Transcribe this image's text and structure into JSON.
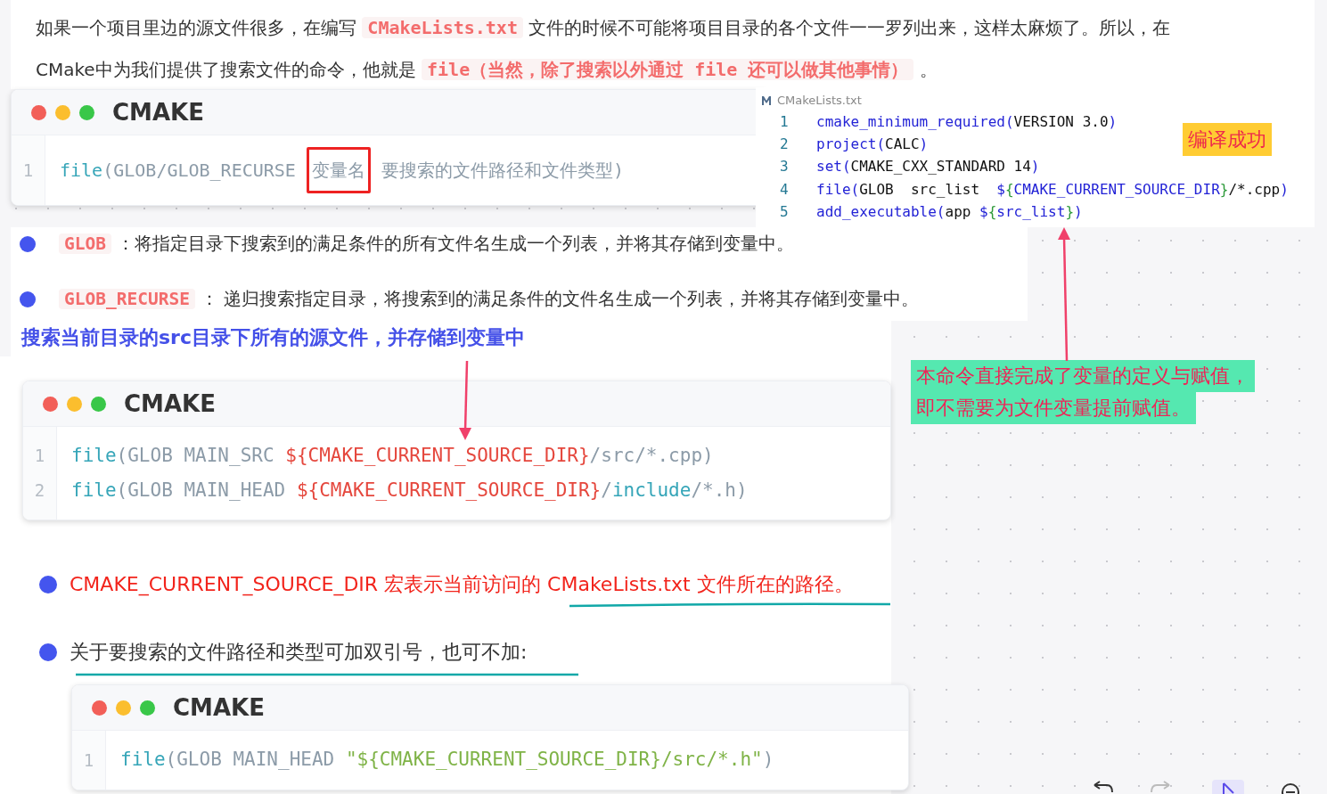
{
  "intro": {
    "lines": [
      [
        {
          "kind": "text",
          "text": "如果一个项目里边的源文件很多，在编写 "
        },
        {
          "kind": "code",
          "text": "CMakeLists.txt"
        },
        {
          "kind": "text",
          "text": " 文件的时候不可能将项目目录的各个文件一一罗列出来，这样太麻烦了。所以，在"
        }
      ],
      [
        {
          "kind": "text",
          "text": "CMake中为我们提供了搜索文件的命令，他就是 "
        },
        {
          "kind": "code",
          "text": "file（当然，除了搜索以外通过 file 还可以做其他事情）"
        },
        {
          "kind": "text",
          "text": " 。"
        }
      ]
    ]
  },
  "syntax_block": {
    "title": "CMAKE",
    "lines": [
      {
        "number": "1",
        "tokens": [
          {
            "kind": "keyword",
            "text": "file"
          },
          {
            "kind": "plain",
            "text": "(GLOB/GLOB_RECURSE "
          },
          {
            "kind": "boxed",
            "text": "变量名"
          },
          {
            "kind": "plain",
            "text": " 要搜索的文件路径和文件类型)"
          }
        ]
      }
    ]
  },
  "file_clip": {
    "filename": "CMakeLists.txt",
    "badge": "编译成功",
    "lines": [
      {
        "number": "1",
        "tokens": [
          {
            "kind": "func",
            "text": "cmake_minimum_required("
          },
          {
            "kind": "text",
            "text": "VERSION 3.0"
          },
          {
            "kind": "func",
            "text": ")"
          }
        ]
      },
      {
        "number": "2",
        "tokens": [
          {
            "kind": "func",
            "text": "project("
          },
          {
            "kind": "text",
            "text": "CALC"
          },
          {
            "kind": "func",
            "text": ")"
          }
        ]
      },
      {
        "number": "3",
        "tokens": [
          {
            "kind": "func",
            "text": "set("
          },
          {
            "kind": "text",
            "text": "CMAKE_CXX_STANDARD 14"
          },
          {
            "kind": "func",
            "text": ")"
          }
        ]
      },
      {
        "number": "4",
        "tokens": [
          {
            "kind": "func",
            "text": "file("
          },
          {
            "kind": "text",
            "text": "GLOB  src_list  "
          },
          {
            "kind": "func",
            "text": "$"
          },
          {
            "kind": "brace",
            "text": "{"
          },
          {
            "kind": "func",
            "text": "CMAKE_CURRENT_SOURCE_DIR"
          },
          {
            "kind": "brace",
            "text": "}"
          },
          {
            "kind": "text",
            "text": "/*.cpp"
          },
          {
            "kind": "func",
            "text": ")"
          }
        ]
      },
      {
        "number": "5",
        "tokens": [
          {
            "kind": "func",
            "text": "add_executable("
          },
          {
            "kind": "text",
            "text": "app "
          },
          {
            "kind": "func",
            "text": "$"
          },
          {
            "kind": "brace",
            "text": "{"
          },
          {
            "kind": "func",
            "text": "src_list"
          },
          {
            "kind": "brace",
            "text": "}"
          },
          {
            "kind": "func",
            "text": ")"
          }
        ]
      }
    ]
  },
  "bullets_top": [
    [
      {
        "kind": "code",
        "text": "GLOB"
      },
      {
        "kind": "text",
        "text": " ：将指定目录下搜索到的满足条件的所有文件名生成一个列表，并将其存储到变量中。"
      }
    ],
    [
      {
        "kind": "code",
        "text": "GLOB_RECURSE"
      },
      {
        "kind": "text",
        "text": " ： 递归搜索指定目录，将搜索到的满足条件的文件名生成一个列表，并将其存储到变量中。"
      }
    ]
  ],
  "heading": "搜索当前目录的src目录下所有的源文件，并存储到变量中",
  "note": {
    "lines": [
      "本命令直接完成了变量的定义与赋值，",
      "即不需要为文件变量提前赋值。"
    ]
  },
  "example_block": {
    "title": "CMAKE",
    "lines": [
      {
        "number": "1",
        "tokens": [
          {
            "kind": "keyword",
            "text": "file"
          },
          {
            "kind": "plain",
            "text": "(GLOB MAIN_SRC "
          },
          {
            "kind": "var",
            "text": "${CMAKE_CURRENT_SOURCE_DIR}"
          },
          {
            "kind": "plain",
            "text": "/src/*.cpp)"
          }
        ]
      },
      {
        "number": "2",
        "tokens": [
          {
            "kind": "keyword",
            "text": "file"
          },
          {
            "kind": "plain",
            "text": "(GLOB MAIN_HEAD "
          },
          {
            "kind": "var",
            "text": "${CMAKE_CURRENT_SOURCE_DIR}"
          },
          {
            "kind": "plain",
            "text": "/"
          },
          {
            "kind": "keyword",
            "text": "include"
          },
          {
            "kind": "plain",
            "text": "/*.h)"
          }
        ]
      }
    ]
  },
  "bullets_bottom": [
    {
      "kind": "alert",
      "text": "CMAKE_CURRENT_SOURCE_DIR 宏表示当前访问的 CMakeLists.txt 文件所在的路径。"
    },
    {
      "kind": "text",
      "text": "关于要搜索的文件路径和类型可加双引号，也可不加:"
    }
  ],
  "quoted_block": {
    "title": "CMAKE",
    "lines": [
      {
        "number": "1",
        "tokens": [
          {
            "kind": "keyword",
            "text": "file"
          },
          {
            "kind": "plain",
            "text": "(GLOB MAIN_HEAD "
          },
          {
            "kind": "string",
            "text": "\"${CMAKE_CURRENT_SOURCE_DIR}/src/*.h\""
          },
          {
            "kind": "plain",
            "text": ")"
          }
        ]
      }
    ]
  }
}
